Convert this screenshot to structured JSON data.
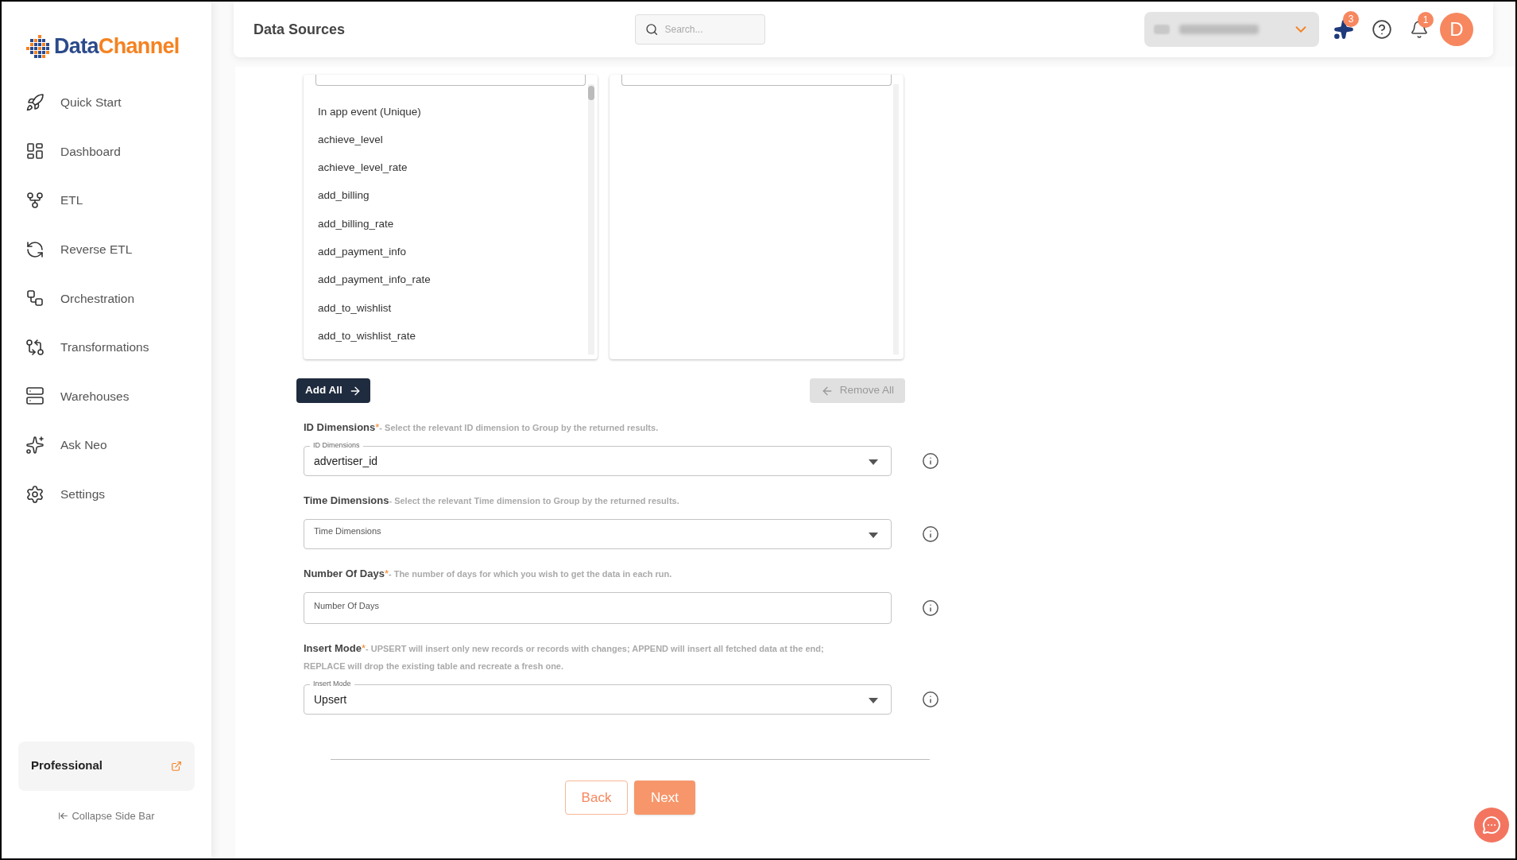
{
  "brand": {
    "part1": "Data",
    "part2": "Channel"
  },
  "sidebar": {
    "items": [
      {
        "label": "Quick Start"
      },
      {
        "label": "Dashboard"
      },
      {
        "label": "ETL"
      },
      {
        "label": "Reverse ETL"
      },
      {
        "label": "Orchestration"
      },
      {
        "label": "Transformations"
      },
      {
        "label": "Warehouses"
      },
      {
        "label": "Ask Neo"
      },
      {
        "label": "Settings"
      }
    ],
    "plan": "Professional",
    "collapse": "Collapse Side Bar"
  },
  "header": {
    "title": "Data Sources",
    "search": {
      "placeholder": "Search..."
    },
    "sparkle_badge": "3",
    "notification_badge": "1",
    "avatar": "D"
  },
  "available_list": [
    "In app event (Unique)",
    "achieve_level",
    "achieve_level_rate",
    "add_billing",
    "add_billing_rate",
    "add_payment_info",
    "add_payment_info_rate",
    "add_to_wishlist",
    "add_to_wishlist_rate"
  ],
  "add_all": {
    "label": "Add All",
    "disabled": false
  },
  "remove_all": {
    "label": "Remove All",
    "disabled": true
  },
  "fields": [
    {
      "kind": "select",
      "title": "ID Dimensions",
      "required_mark": "*",
      "help": "- Select the relevant ID dimension to Group by the returned results.",
      "floating_label": "ID Dimensions",
      "value": "advertiser_id"
    },
    {
      "kind": "select",
      "title": "Time Dimensions",
      "help": "- Select the relevant Time dimension to Group by the returned results.",
      "placeholder": "Time Dimensions"
    },
    {
      "kind": "input",
      "title": "Number Of Days",
      "required_mark": "*",
      "help": "- The number of days for which you wish to get the data in each run.",
      "placeholder": "Number Of Days"
    },
    {
      "kind": "select",
      "title": "Insert Mode",
      "required_mark": "*",
      "help": "- UPSERT will insert only new records or records with changes; APPEND will insert all fetched data at the end; REPLACE will drop the existing table and recreate a fresh one.",
      "floating_label": "Insert Mode",
      "value": "Upsert"
    }
  ],
  "buttons": {
    "back": "Back",
    "next": "Next"
  }
}
